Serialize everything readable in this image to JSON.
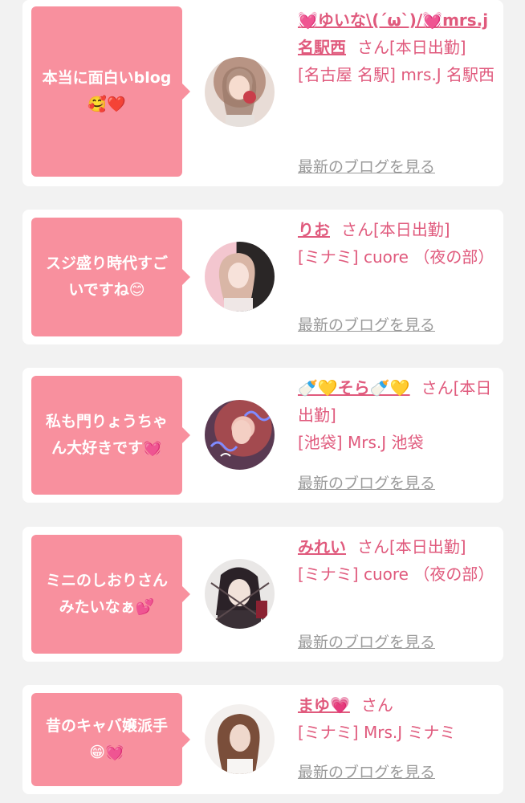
{
  "accent_color": "#e05a7d",
  "bubble_color": "#f8909e",
  "entries": [
    {
      "comment": "本当に面白いblog🥰❤️",
      "name": "💓ゆいな\\(´ω`)/💓mrs.j名駅西",
      "san": "さん",
      "status": "[本日出勤]",
      "shop": "[名古屋 名駅] mrs.J 名駅西",
      "link": "最新のブログを見る",
      "avatar_icon": "avatar-photo-icon"
    },
    {
      "comment": "スジ盛り時代すごいですね😊",
      "name": "りお",
      "san": "さん",
      "status": "[本日出勤]",
      "shop": "[ミナミ] cuore （夜の部）",
      "link": "最新のブログを見る",
      "avatar_icon": "avatar-photo-icon"
    },
    {
      "comment": "私も門りょうちゃん大好きです💓",
      "name": "🍼💛そら🍼💛",
      "san": "さん",
      "status": "[本日出勤]",
      "shop": "[池袋] Mrs.J 池袋",
      "link": "最新のブログを見る",
      "avatar_icon": "avatar-photo-icon"
    },
    {
      "comment": "ミニのしおりさんみたいなぁ💕",
      "name": "みれい",
      "san": "さん",
      "status": "[本日出勤]",
      "shop": "[ミナミ] cuore （夜の部）",
      "link": "最新のブログを見る",
      "avatar_icon": "avatar-anime-icon"
    },
    {
      "comment": "昔のキャバ嬢派手😁💓",
      "name": "まゆ💗",
      "san": "さん",
      "status": "",
      "shop": "[ミナミ] Mrs.J ミナミ",
      "link": "最新のブログを見る",
      "avatar_icon": "avatar-photo-icon"
    }
  ]
}
